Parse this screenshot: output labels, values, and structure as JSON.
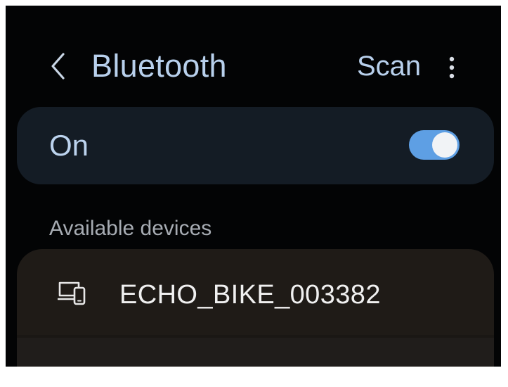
{
  "header": {
    "title": "Bluetooth",
    "scan_label": "Scan",
    "back_icon": "chevron-left-icon",
    "more_icon": "more-vertical-icon"
  },
  "bluetooth_toggle": {
    "label": "On",
    "state": "on"
  },
  "available_devices": {
    "title": "Available devices",
    "devices": [
      {
        "name": "ECHO_BIKE_003382",
        "icon": "device-laptop-phone-icon"
      }
    ]
  },
  "colors": {
    "background": "#030405",
    "accent_text": "#b8d0ec",
    "toggle_card": "#141c25",
    "switch_on": "#5e9fe4",
    "device_card": "#1f1b17"
  }
}
